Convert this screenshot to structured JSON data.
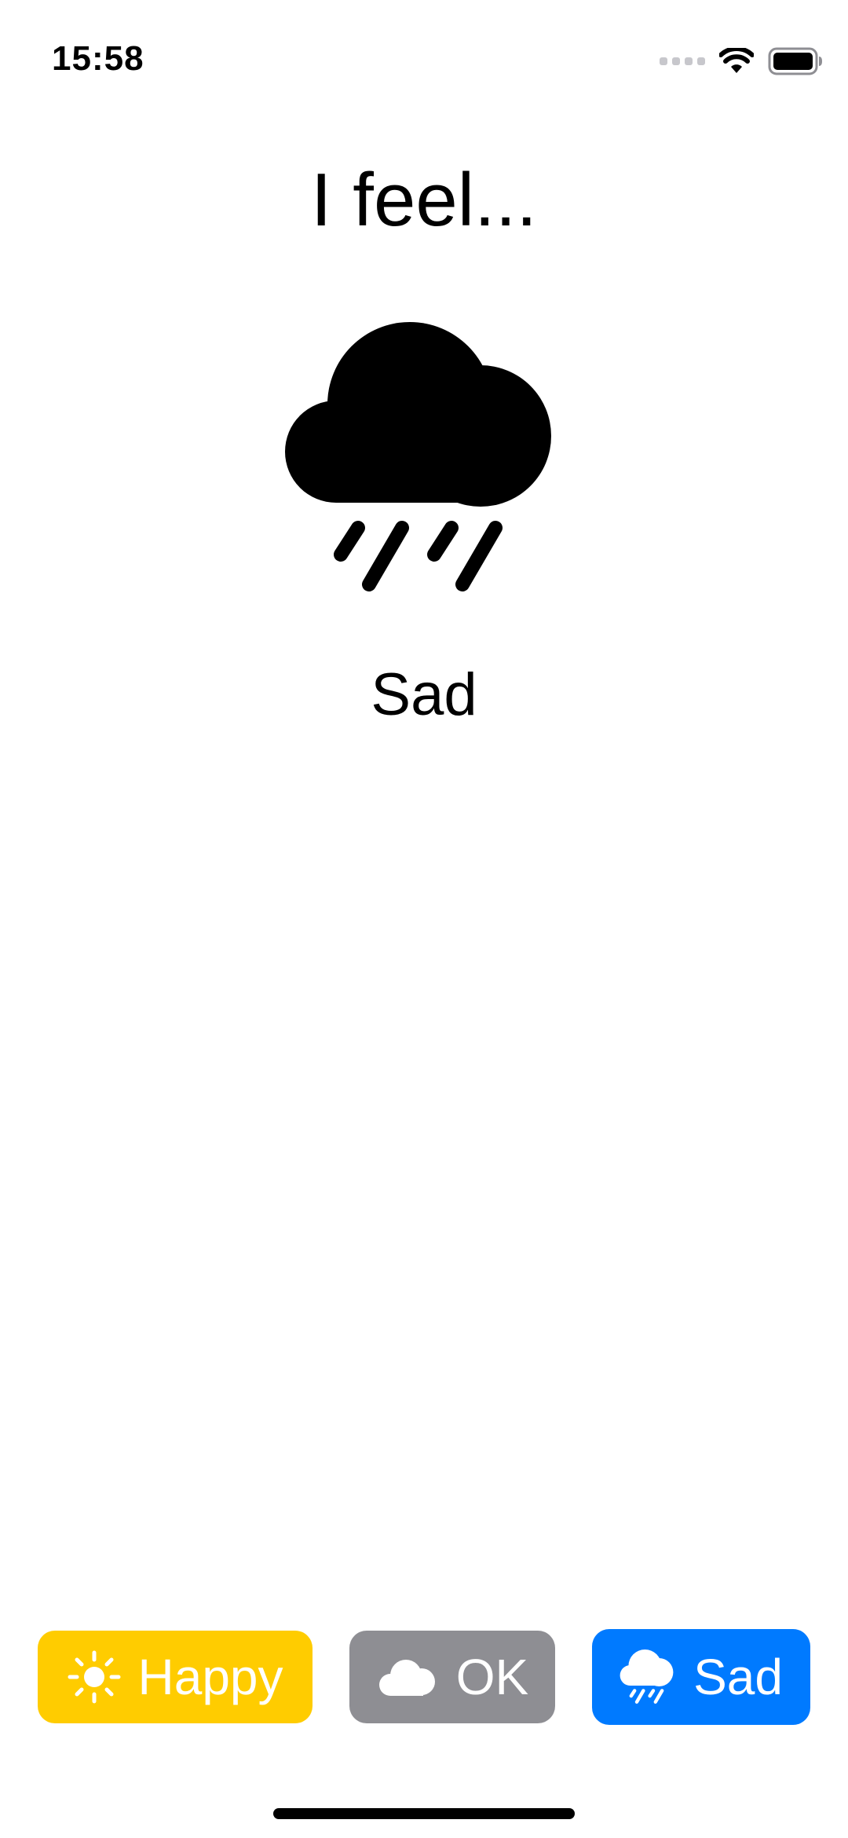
{
  "status_bar": {
    "time": "15:58",
    "icons": [
      "cellular-signal-icon",
      "wifi-icon",
      "battery-icon"
    ]
  },
  "title": "I feel...",
  "current_mood": {
    "icon": "cloud-rain-icon",
    "label": "Sad"
  },
  "mood_buttons": [
    {
      "label": "Happy",
      "icon": "sun-icon",
      "color": "#FFCC00"
    },
    {
      "label": "OK",
      "icon": "cloud-icon",
      "color": "#8E8E93"
    },
    {
      "label": "Sad",
      "icon": "cloud-rain-icon",
      "color": "#007AFF"
    }
  ]
}
